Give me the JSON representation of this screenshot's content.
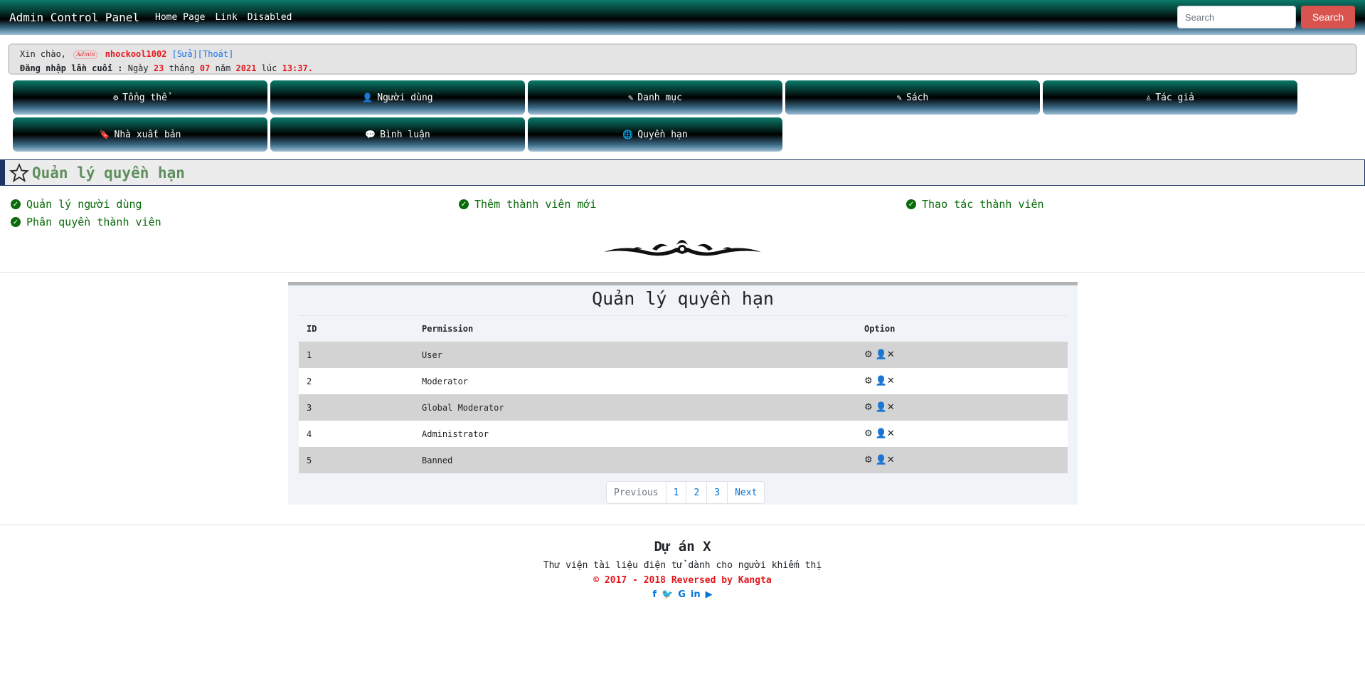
{
  "navbar": {
    "brand": "Admin Control Panel",
    "links": [
      "Home Page",
      "Link",
      "Disabled"
    ],
    "search_placeholder": "Search",
    "search_button": "Search"
  },
  "welcome": {
    "greeting": "Xin chào,",
    "badge": "Admin",
    "username": "nhockool1002",
    "edit": "[Sửa]",
    "logout": "[Thoát]",
    "last_login_label": "Đăng nhập lần cuối :",
    "day_label": "Ngày",
    "day": "23",
    "month_label": "tháng",
    "month": "07",
    "year_label": "năm",
    "year": "2021",
    "time_label": "lúc",
    "time": "13:37"
  },
  "menu": [
    {
      "label": "Tổng thể",
      "icon": "gear-icon"
    },
    {
      "label": "Người dùng",
      "icon": "user-icon"
    },
    {
      "label": "Danh mục",
      "icon": "edit-icon"
    },
    {
      "label": "Sách",
      "icon": "edit-icon"
    },
    {
      "label": "Tác giả",
      "icon": "male-icon"
    },
    {
      "label": "Nhà xuất bản",
      "icon": "bookmark-icon"
    },
    {
      "label": "Bình luận",
      "icon": "comment-icon"
    },
    {
      "label": "Quyền hạn",
      "icon": "globe-icon"
    }
  ],
  "section": {
    "title": "Quản lý quyền hạn",
    "features": [
      "Quản lý người dùng",
      "Thêm thành viên mới",
      "Thao tác thành viên",
      "Phân quyền thành viên"
    ]
  },
  "panel": {
    "title": "Quản lý quyền hạn",
    "columns": [
      "ID",
      "Permission",
      "Option"
    ],
    "rows": [
      {
        "id": "1",
        "permission": "User"
      },
      {
        "id": "2",
        "permission": "Moderator"
      },
      {
        "id": "3",
        "permission": "Global Moderator"
      },
      {
        "id": "4",
        "permission": "Administrator"
      },
      {
        "id": "5",
        "permission": "Banned"
      }
    ]
  },
  "pagination": {
    "previous": "Previous",
    "pages": [
      "1",
      "2",
      "3"
    ],
    "next": "Next"
  },
  "footer": {
    "title": "Dự án X",
    "subtitle": "Thư viện tài liệu điện tử dành cho người khiếm thị",
    "copyright": "© 2017 - 2018 Reversed by Kangta",
    "social": [
      "facebook-icon",
      "twitter-icon",
      "google-icon",
      "linkedin-icon",
      "youtube-icon"
    ]
  },
  "colors": {
    "accent_red": "#e3161c",
    "link_blue": "#0275d8",
    "success_green": "#0a6b0a",
    "search_button": "#d9534f"
  }
}
